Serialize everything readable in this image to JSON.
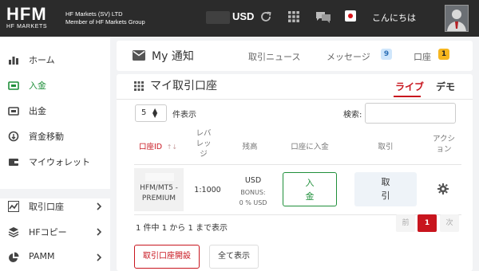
{
  "header": {
    "logo_text": "HFM",
    "logo_sub": "HF MARKETS",
    "company_line1": "HF Markets (SV) LTD",
    "company_line2": "Member of HF Markets Group",
    "currency": "USD",
    "greeting": "こんにちは",
    "icons": [
      "refresh-icon",
      "apps-grid-icon",
      "chat-icon",
      "japan-flag-icon"
    ]
  },
  "sidebar": {
    "items": [
      {
        "label": "ホーム",
        "icon": "bar-chart-icon"
      },
      {
        "label": "入金",
        "icon": "deposit-icon",
        "active": true
      },
      {
        "label": "出金",
        "icon": "withdraw-icon"
      },
      {
        "label": "資金移動",
        "icon": "transfer-icon"
      },
      {
        "label": "マイウォレット",
        "icon": "wallet-icon"
      },
      {
        "label": "取引口座",
        "icon": "line-chart-icon",
        "expandable": true
      },
      {
        "label": "HFコピー",
        "icon": "layers-icon",
        "expandable": true
      },
      {
        "label": "PAMM",
        "icon": "pie-chart-icon",
        "expandable": true
      }
    ]
  },
  "notifications": {
    "title": "My 通知",
    "news_label": "取引ニュース",
    "messages_label": "メッセージ",
    "messages_count": "9",
    "accounts_label": "口座",
    "accounts_count": "1"
  },
  "accounts": {
    "title": "マイ取引口座",
    "tab_live": "ライブ",
    "tab_demo": "デモ",
    "page_size": "5",
    "page_size_suffix": "件表示",
    "search_label": "検索:",
    "columns": {
      "account_id": "口座ID",
      "leverage": "レバ\nレッ\nジ",
      "balance": "残高",
      "deposit": "口座に入金",
      "trade": "取引",
      "action": "アクシ\nョン"
    },
    "row": {
      "account_type": "HFM/MT5 -\nPREMIUM",
      "leverage": "1:1000",
      "balance_currency": "USD",
      "bonus_label": "BONUS:",
      "bonus_value": "0 % USD",
      "deposit_button": "入\n金",
      "trade_button": "取\n引"
    },
    "info": "1 件中 1 から 1 まで表示",
    "pagination": {
      "prev": "前",
      "current": "1",
      "next": "次"
    },
    "open_account_button": "取引口座開設",
    "show_all_button": "全て表示"
  },
  "colors": {
    "brand_red": "#c8151e",
    "active_green": "#1f8f3a",
    "header_bg": "#2b2b2b"
  }
}
